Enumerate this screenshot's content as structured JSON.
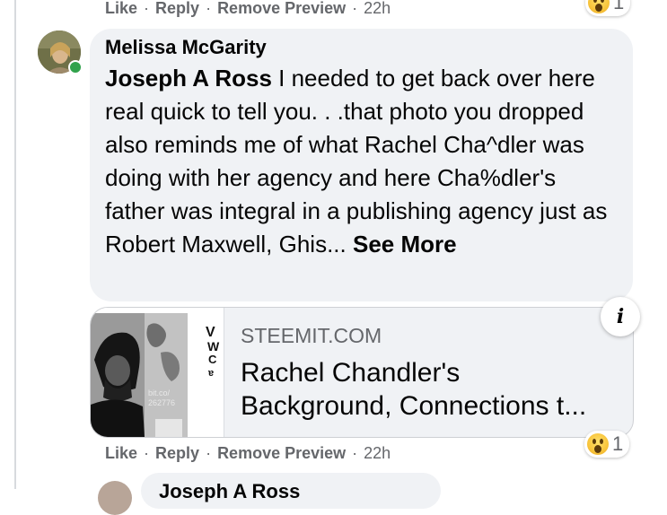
{
  "top_actions": {
    "like": "Like",
    "reply": "Reply",
    "remove_preview": "Remove Preview",
    "separator": "·",
    "time": "22h"
  },
  "top_reaction": {
    "icon": "wow-emoji-icon",
    "count": "1"
  },
  "comment": {
    "author": "Melissa McGarity",
    "mention": "Joseph A Ross",
    "text": " I needed to get back over here real quick to tell you. . .that photo you dropped also reminds me of what Rachel Cha^dler was doing with her agency and here Cha%dler's father was integral in a publishing agency just as Robert Maxwell, Ghis... ",
    "see_more": "See More"
  },
  "link_preview": {
    "thumbnail": {
      "caption": "bit.co/ 262776"
    },
    "domain": "STEEMIT.COM",
    "title_line1": "Rachel Chandler's",
    "title_line2": "Background, Connections t..."
  },
  "bottom_actions": {
    "like": "Like",
    "reply": "Reply",
    "remove_preview": "Remove Preview",
    "separator": "·",
    "time": "22h"
  },
  "bottom_reaction": {
    "icon": "wow-emoji-icon",
    "count": "1"
  },
  "next_reply": {
    "author": "Joseph A Ross"
  },
  "colors": {
    "bubble": "#f0f2f5",
    "secondary_text": "#65676b",
    "presence": "#31a24c"
  }
}
